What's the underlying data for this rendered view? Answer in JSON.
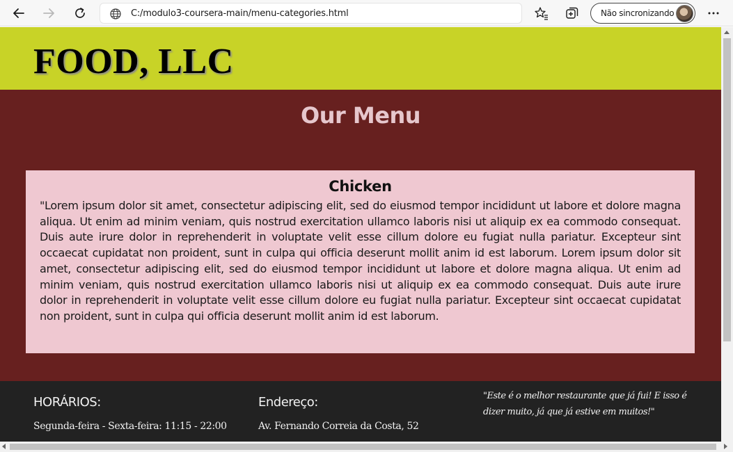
{
  "browser": {
    "url": "C:/modulo3-coursera-main/menu-categories.html",
    "sync_label": "Não sincronizando",
    "icons": {
      "back": "back-arrow-icon",
      "forward": "forward-arrow-icon",
      "refresh": "refresh-icon",
      "site_info": "globe-icon",
      "favorites": "favorites-star-icon",
      "collections": "collections-icon",
      "more": "more-dots-icon"
    }
  },
  "header": {
    "brand": "FOOD, LLC",
    "bg_color": "#c8d327"
  },
  "main": {
    "title": "Our Menu",
    "bg_color": "#67201f",
    "card": {
      "title": "Chicken",
      "text": "\"Lorem ipsum dolor sit amet, consectetur adipiscing elit, sed do eiusmod tempor incididunt ut labore et dolore magna aliqua. Ut enim ad minim veniam, quis nostrud exercitation ullamco laboris nisi ut aliquip ex ea commodo consequat. Duis aute irure dolor in reprehenderit in voluptate velit esse cillum dolore eu fugiat nulla pariatur. Excepteur sint occaecat cupidatat non proident, sunt in culpa qui officia deserunt mollit anim id est laborum. Lorem ipsum dolor sit amet, consectetur adipiscing elit, sed do eiusmod tempor incididunt ut labore et dolore magna aliqua. Ut enim ad minim veniam, quis nostrud exercitation ullamco laboris nisi ut aliquip ex ea commodo consequat. Duis aute irure dolor in reprehenderit in voluptate velit esse cillum dolore eu fugiat nulla pariatur. Excepteur sint occaecat cupidatat non proident, sunt in culpa qui officia deserunt mollit anim id est laborum.",
      "bg_color": "#efc8d1"
    }
  },
  "footer": {
    "hours_heading": "HORÁRIOS:",
    "hours_text": "Segunda-feira - Sexta-feira: 11:15 - 22:00",
    "address_heading": "Endereço:",
    "address_text": "Av. Fernando Correia da Costa, 52",
    "testimonial": "\"Este é o melhor restaurante que já fui! E isso é dizer muito, já que já estive em muitos!\"",
    "bg_color": "#222222"
  }
}
